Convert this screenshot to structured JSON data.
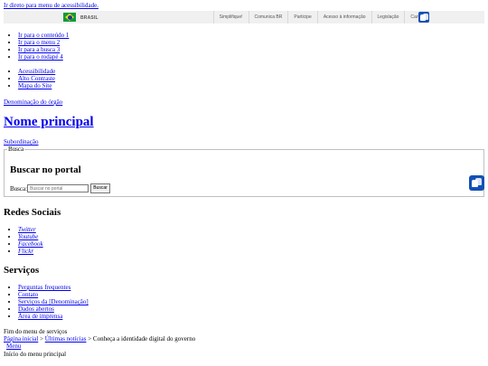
{
  "skip_link": "Ir direto para menu de acessibilidade.",
  "gov_bar": {
    "brasil": "BRASIL",
    "links": [
      "Simplifique!",
      "Comunica BR",
      "Participe",
      "Acesso à informação",
      "Legislação",
      "Canais"
    ]
  },
  "skip_links": [
    "Ir para o conteúdo 1",
    "Ir para o menu 2",
    "Ir para a busca 3",
    "Ir para o rodapé 4"
  ],
  "accessibility_links": [
    "Acessibilidade",
    "Alto Contraste",
    "Mapa do Site"
  ],
  "header": {
    "denomination": "Denominação do órgão",
    "main_name": "Nome principal",
    "subordination": "Subordinação"
  },
  "search": {
    "legend": "Busca",
    "heading": "Buscar no portal",
    "label": "Busca:",
    "placeholder": "Buscar no portal",
    "button": "Buscar"
  },
  "social": {
    "heading": "Redes Sociais",
    "items": [
      "Twitter",
      "Youtube",
      "Facebook",
      "Flickr"
    ]
  },
  "services": {
    "heading": "Serviços",
    "items": [
      "Perguntas frequentes",
      "Contato",
      "Serviços da [Denominação]",
      "Dados abertos",
      "Área de imprensa"
    ]
  },
  "end_services": "Fim do menu de serviços",
  "breadcrumb": {
    "home": "Página inicial",
    "sep": " > ",
    "news": "Últimas notícias",
    "current": "Conheça a identidade digital do governo"
  },
  "menu_link": "Menu",
  "main_menu_start": "Início do menu principal",
  "colors": {
    "gov_bar_bg": "#f0f0f0",
    "vlibras_blue": "#1351b4",
    "flag_green": "#0c9b3c",
    "flag_yellow": "#f7dd16"
  },
  "icons": {
    "vlibras": "hands-sign-language-icon",
    "flag": "brazil-flag-icon"
  }
}
